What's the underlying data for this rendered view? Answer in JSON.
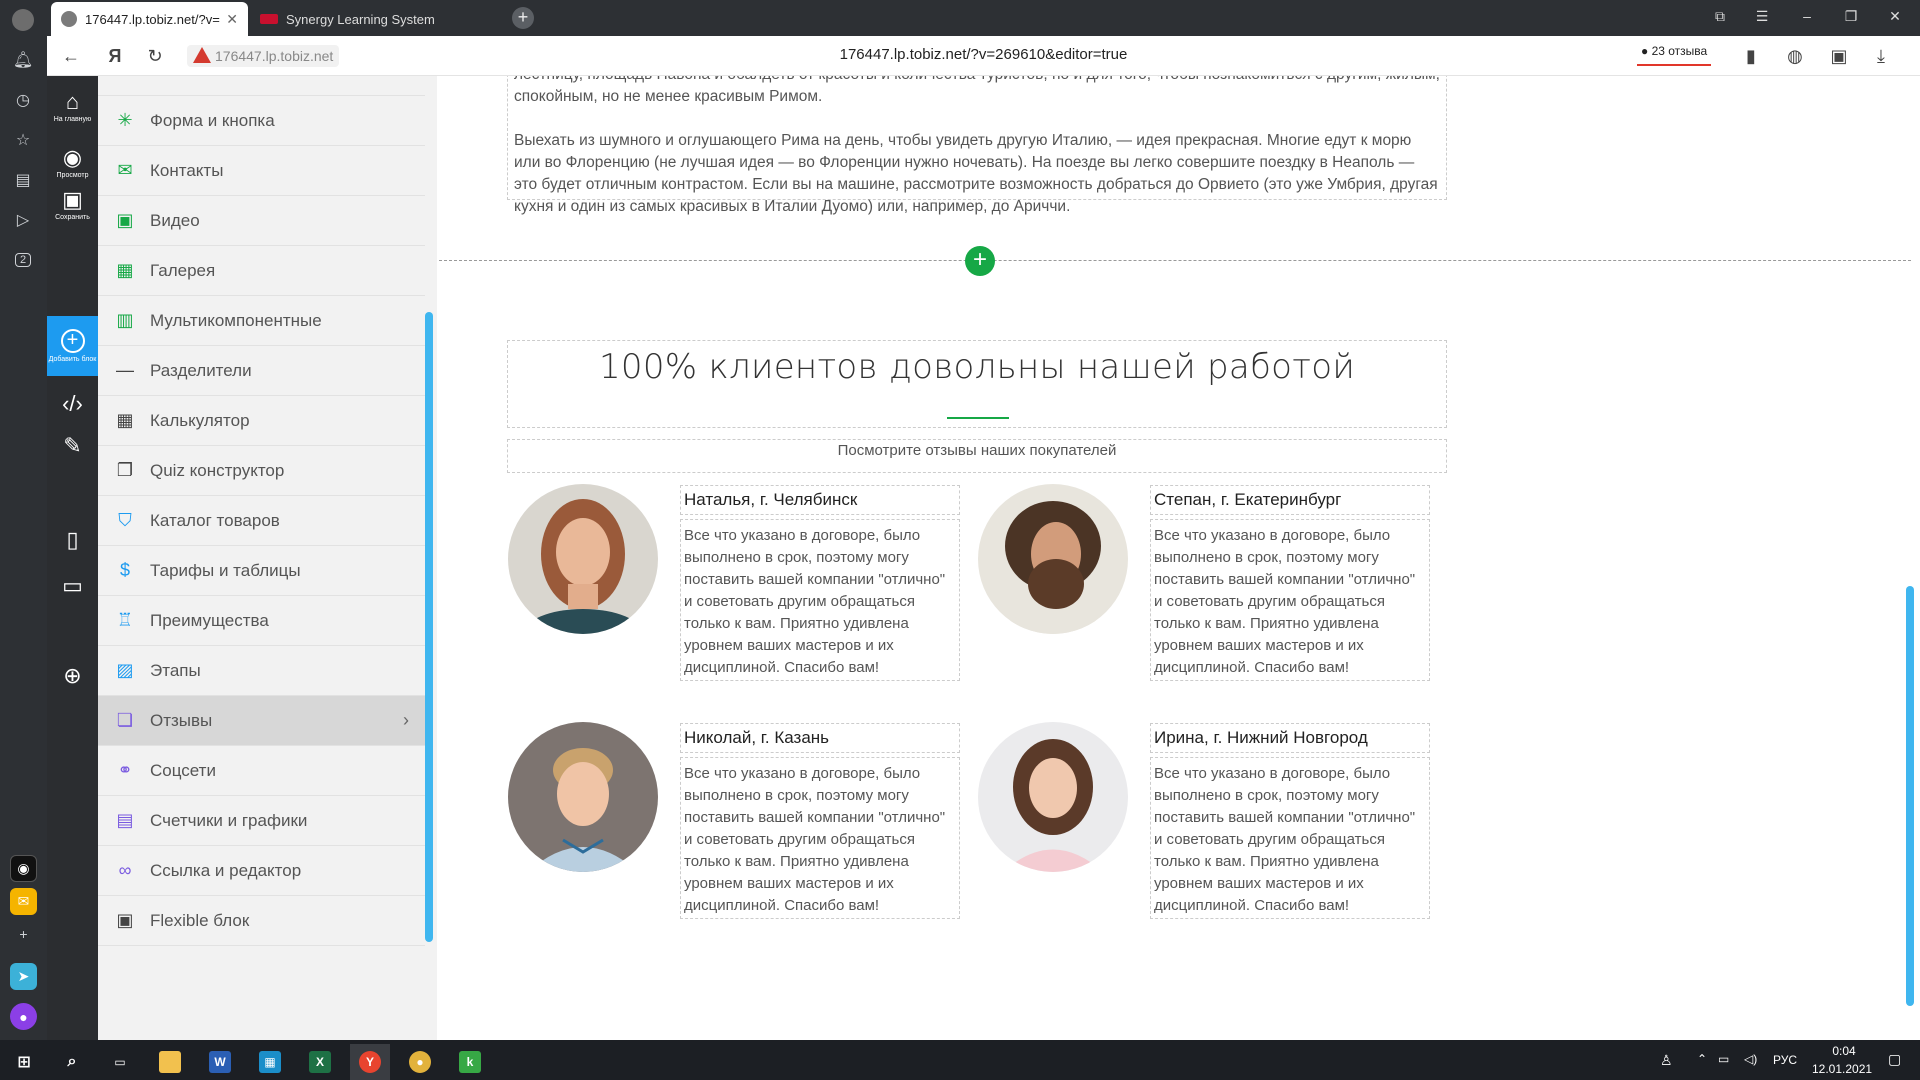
{
  "browser": {
    "tabs": [
      {
        "title": "176447.lp.tobiz.net/?v=",
        "active": true
      },
      {
        "title": "Synergy Learning System",
        "active": false
      }
    ],
    "address_short": "176447.lp.tobiz.net",
    "address_full": "176447.lp.tobiz.net/?v=269610&editor=true",
    "reviews_button": "23 отзыва",
    "rail_badge": "2"
  },
  "tools": {
    "home": "На главную",
    "preview": "Просмотр",
    "save": "Сохранить",
    "add_block": "Добавить блок"
  },
  "menu": {
    "items": [
      {
        "label": "Форма и кнопка",
        "icon": "form-icon",
        "color": "#16a846"
      },
      {
        "label": "Контакты",
        "icon": "mail-icon",
        "color": "#16a846"
      },
      {
        "label": "Видео",
        "icon": "video-icon",
        "color": "#16a846"
      },
      {
        "label": "Галерея",
        "icon": "gallery-icon",
        "color": "#16a846"
      },
      {
        "label": "Мультикомпонентные",
        "icon": "blocks-icon",
        "color": "#16a846"
      },
      {
        "label": "Разделители",
        "icon": "divider-icon",
        "color": "#444444"
      },
      {
        "label": "Калькулятор",
        "icon": "calculator-icon",
        "color": "#444444"
      },
      {
        "label": "Quiz конструктор",
        "icon": "quiz-icon",
        "color": "#444444"
      },
      {
        "label": "Каталог товаров",
        "icon": "basket-icon",
        "color": "#1d9bf0"
      },
      {
        "label": "Тарифы и таблицы",
        "icon": "dollar-icon",
        "color": "#1d9bf0"
      },
      {
        "label": "Преимущества",
        "icon": "trophy-icon",
        "color": "#1d9bf0"
      },
      {
        "label": "Этапы",
        "icon": "chart-icon",
        "color": "#1d9bf0"
      },
      {
        "label": "Отзывы",
        "icon": "reviews-icon",
        "color": "#7a5be0"
      },
      {
        "label": "Соцсети",
        "icon": "share-icon",
        "color": "#7a5be0"
      },
      {
        "label": "Счетчики и графики",
        "icon": "counter-icon",
        "color": "#7a5be0"
      },
      {
        "label": "Ссылка и редактор",
        "icon": "link-icon",
        "color": "#7a5be0"
      },
      {
        "label": "Flexible блок",
        "icon": "flexible-icon",
        "color": "#444444"
      }
    ],
    "active_item": "Отзывы"
  },
  "page": {
    "prev_paragraph_1": "лестницу, площадь Навона и обалдеть от красоты и количества туристов, но и для того, чтобы познакомиться с другим, жилым, спокойным, но не менее красивым Римом.",
    "prev_paragraph_2": "Выехать из шумного и оглушающего Рима на день, чтобы увидеть другую Италию, — идея прекрасная. Многие едут к морю или во Флоренцию (не лучшая идея — во Флоренции нужно ночевать). На поезде вы легко совершите поездку в Неаполь — это будет отличным контрастом. Если вы на машине, рассмотрите возможность добраться до Орвието (это уже Умбрия, другая кухня и один из самых красивых в Италии Дуомо) или, например, до Ариччи.",
    "heading": "100% клиентов довольны нашей работой",
    "subheading": "Посмотрите отзывы наших покупателей",
    "reviews": [
      {
        "name": "Наталья, г. Челябинск",
        "text": "Все что указано в договоре, было выполнено в срок, поэтому могу поставить вашей компании \"отлично\" и советовать другим обращаться только к вам. Приятно удивлена уровнем ваших мастеров и их дисциплиной. Спасибо вам!"
      },
      {
        "name": "Степан, г. Екатеринбург",
        "text": "Все что указано в договоре, было выполнено в срок, поэтому могу поставить вашей компании \"отлично\" и советовать другим обращаться только к вам. Приятно удивлена уровнем ваших мастеров и их дисциплиной. Спасибо вам!"
      },
      {
        "name": "Николай, г. Казань",
        "text": "Все что указано в договоре, было выполнено в срок, поэтому могу поставить вашей компании \"отлично\" и советовать другим обращаться только к вам. Приятно удивлена уровнем ваших мастеров и их дисциплиной. Спасибо вам!"
      },
      {
        "name": "Ирина, г. Нижний Новгород",
        "text": "Все что указано в договоре, было выполнено в срок, поэтому могу поставить вашей компании \"отлично\" и советовать другим обращаться только к вам. Приятно удивлена уровнем ваших мастеров и их дисциплиной. Спасибо вам!"
      }
    ]
  },
  "taskbar": {
    "lang": "РУС",
    "time": "0:04",
    "date": "12.01.2021"
  },
  "colors": {
    "accent_green": "#16a846",
    "accent_blue": "#1d9bf0",
    "active_menu_bg": "#d7d7d7"
  }
}
